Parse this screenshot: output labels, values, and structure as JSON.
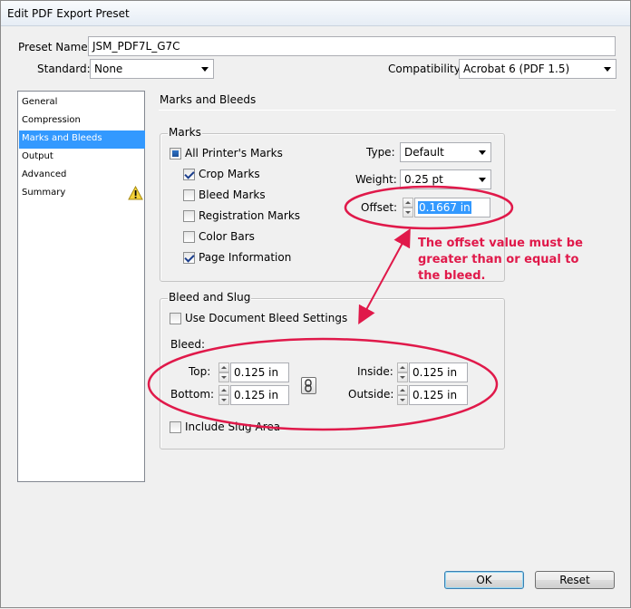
{
  "window": {
    "title": "Edit PDF Export Preset"
  },
  "preset": {
    "label": "Preset Name:",
    "value": "JSM_PDF7L_G7C"
  },
  "standard": {
    "label": "Standard:",
    "value": "None"
  },
  "compatibility": {
    "label": "Compatibility:",
    "value": "Acrobat 6 (PDF 1.5)"
  },
  "sidebar": {
    "items": [
      {
        "label": "General"
      },
      {
        "label": "Compression"
      },
      {
        "label": "Marks and Bleeds"
      },
      {
        "label": "Output"
      },
      {
        "label": "Advanced"
      },
      {
        "label": "Summary"
      }
    ],
    "selected": "Marks and Bleeds"
  },
  "panel": {
    "title": "Marks and Bleeds"
  },
  "marks": {
    "title": "Marks",
    "all_printers_marks": "All Printer's Marks",
    "crop_marks": "Crop Marks",
    "bleed_marks": "Bleed Marks",
    "registration_marks": "Registration Marks",
    "color_bars": "Color Bars",
    "page_information": "Page Information",
    "type_label": "Type:",
    "type_value": "Default",
    "weight_label": "Weight:",
    "weight_value": "0.25 pt",
    "offset_label": "Offset:",
    "offset_value": "0.1667 in"
  },
  "bleed": {
    "title": "Bleed and Slug",
    "use_doc": "Use Document Bleed Settings",
    "bleed_label": "Bleed:",
    "top_label": "Top:",
    "top_value": "0.125 in",
    "bottom_label": "Bottom:",
    "bottom_value": "0.125 in",
    "inside_label": "Inside:",
    "inside_value": "0.125 in",
    "outside_label": "Outside:",
    "outside_value": "0.125 in",
    "slug": "Include Slug Area"
  },
  "annotation": {
    "line1": "The offset value must be",
    "line2": "greater than or equal to",
    "line3": "the bleed.",
    "color": "#e0194a"
  },
  "buttons": {
    "ok": "OK",
    "reset": "Reset"
  }
}
